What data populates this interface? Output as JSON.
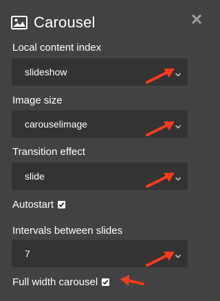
{
  "panel": {
    "title": "Carousel",
    "icon": "image-icon",
    "close_icon": "close-x-icon"
  },
  "fields": {
    "content_index": {
      "label": "Local content index",
      "value": "slideshow"
    },
    "image_size": {
      "label": "Image size",
      "value": "carouselimage"
    },
    "transition": {
      "label": "Transition effect",
      "value": "slide"
    },
    "autostart": {
      "label": "Autostart",
      "checked": true
    },
    "interval": {
      "label": "Intervals between slides",
      "value": "7"
    },
    "full_width": {
      "label": "Full width carousel",
      "checked": true
    }
  },
  "colors": {
    "background": "#424242",
    "select_background": "#333333",
    "text": "#ffffff",
    "annotation_arrow": "#ff3b1a"
  }
}
